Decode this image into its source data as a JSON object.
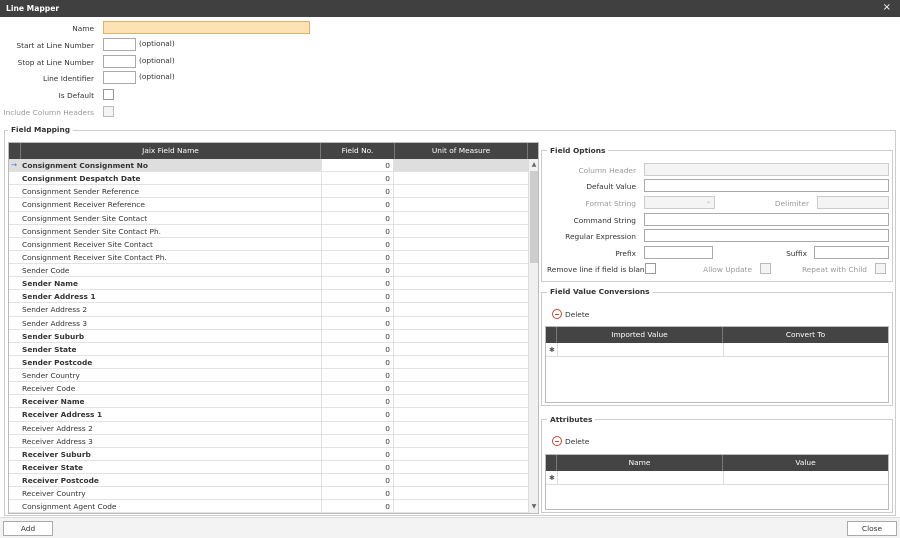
{
  "window": {
    "title": "Line Mapper",
    "close_glyph": "×"
  },
  "form": {
    "name_label": "Name",
    "name_value": "",
    "start_label": "Start at Line Number",
    "start_hint": "(optional)",
    "stop_label": "Stop at Line Number",
    "stop_hint": "(optional)",
    "identifier_label": "Line Identifier",
    "identifier_hint": "(optional)",
    "is_default_label": "Is Default",
    "include_headers_label": "Include Column Headers"
  },
  "field_mapping": {
    "title": "Field Mapping",
    "columns": [
      "Jaix Field Name",
      "Field No.",
      "Unit of Measure"
    ],
    "rows": [
      {
        "name": "Consignment Consignment No",
        "no": "0",
        "bold": true,
        "selected": true
      },
      {
        "name": "Consignment Despatch Date",
        "no": "0",
        "bold": true
      },
      {
        "name": "Consignment Sender Reference",
        "no": "0"
      },
      {
        "name": "Consignment Receiver Reference",
        "no": "0"
      },
      {
        "name": "Consignment Sender Site Contact",
        "no": "0"
      },
      {
        "name": "Consignment Sender Site Contact Ph.",
        "no": "0"
      },
      {
        "name": "Consignment Receiver Site Contact",
        "no": "0"
      },
      {
        "name": "Consignment Receiver Site Contact Ph.",
        "no": "0"
      },
      {
        "name": "Sender Code",
        "no": "0"
      },
      {
        "name": "Sender Name",
        "no": "0",
        "bold": true
      },
      {
        "name": "Sender Address 1",
        "no": "0",
        "bold": true
      },
      {
        "name": "Sender Address 2",
        "no": "0"
      },
      {
        "name": "Sender Address 3",
        "no": "0"
      },
      {
        "name": "Sender Suburb",
        "no": "0",
        "bold": true
      },
      {
        "name": "Sender State",
        "no": "0",
        "bold": true
      },
      {
        "name": "Sender Postcode",
        "no": "0",
        "bold": true
      },
      {
        "name": "Sender Country",
        "no": "0"
      },
      {
        "name": "Receiver Code",
        "no": "0"
      },
      {
        "name": "Receiver Name",
        "no": "0",
        "bold": true
      },
      {
        "name": "Receiver Address 1",
        "no": "0",
        "bold": true
      },
      {
        "name": "Receiver Address 2",
        "no": "0"
      },
      {
        "name": "Receiver Address 3",
        "no": "0"
      },
      {
        "name": "Receiver Suburb",
        "no": "0",
        "bold": true
      },
      {
        "name": "Receiver State",
        "no": "0",
        "bold": true
      },
      {
        "name": "Receiver Postcode",
        "no": "0",
        "bold": true
      },
      {
        "name": "Receiver Country",
        "no": "0"
      },
      {
        "name": "Consignment Agent Code",
        "no": "0"
      }
    ],
    "row_indicator": "→",
    "scroll_up": "▲",
    "scroll_down": "▼"
  },
  "field_options": {
    "title": "Field Options",
    "column_header_label": "Column Header",
    "default_value_label": "Default Value",
    "format_string_label": "Format String",
    "delimiter_label": "Delimiter",
    "command_string_label": "Command String",
    "regex_label": "Regular Expression",
    "prefix_label": "Prefix",
    "suffix_label": "Suffix",
    "remove_line_label": "Remove line if field is blank",
    "allow_update_label": "Allow Update",
    "repeat_child_label": "Repeat with Child"
  },
  "conversions": {
    "title": "Field Value Conversions",
    "delete_label": "Delete",
    "columns": [
      "Imported Value",
      "Convert To"
    ],
    "new_row_glyph": "✱"
  },
  "attributes": {
    "title": "Attributes",
    "delete_label": "Delete",
    "columns": [
      "Name",
      "Value"
    ],
    "new_row_glyph": "✱"
  },
  "footer": {
    "add_label": "Add",
    "close_label": "Close"
  }
}
